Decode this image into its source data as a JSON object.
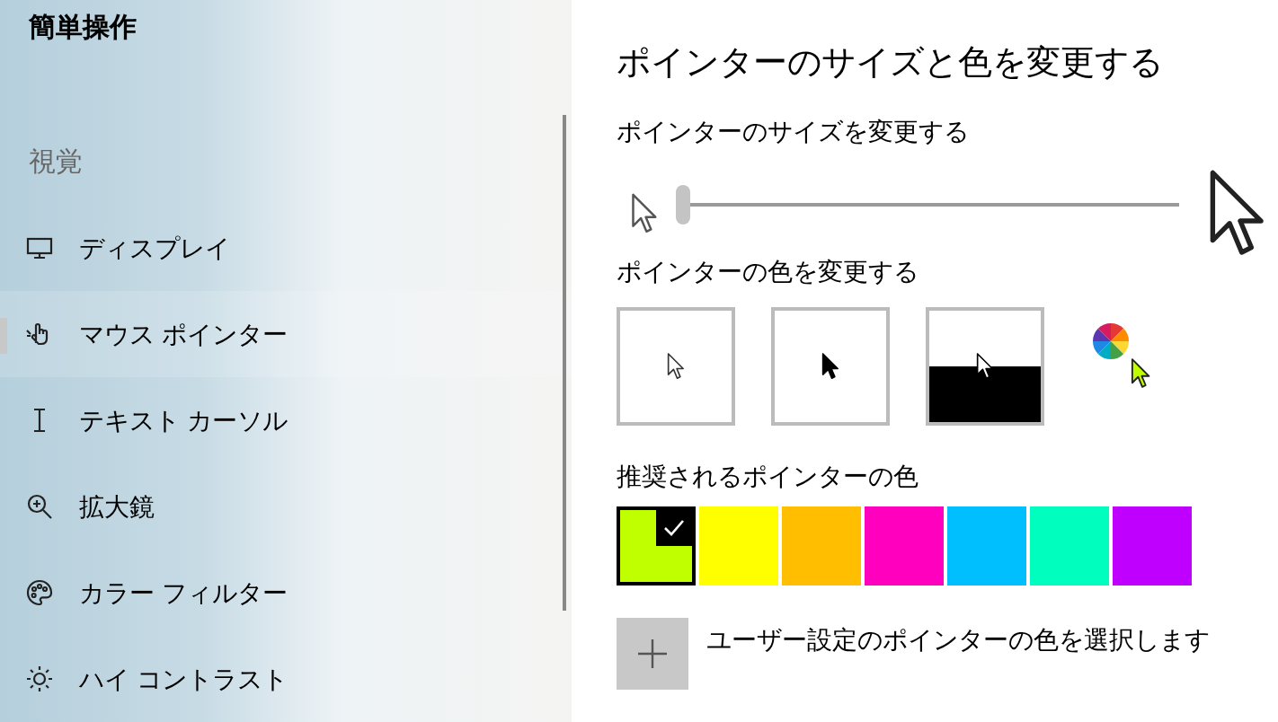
{
  "sidebar": {
    "title": "簡単操作",
    "section": "視覚",
    "items": [
      {
        "label": "ディスプレイ",
        "kind": "monitor",
        "selected": false
      },
      {
        "label": "マウス ポインター",
        "kind": "hand",
        "selected": true
      },
      {
        "label": "テキスト カーソル",
        "kind": "cursor",
        "selected": false
      },
      {
        "label": "拡大鏡",
        "kind": "zoom",
        "selected": false
      },
      {
        "label": "カラー フィルター",
        "kind": "palette",
        "selected": false
      },
      {
        "label": "ハイ コントラスト",
        "kind": "sun",
        "selected": false
      }
    ]
  },
  "main": {
    "title": "ポインターのサイズと色を変更する",
    "size": {
      "label": "ポインターのサイズを変更する",
      "level": 0.0
    },
    "color": {
      "label": "ポインターの色を変更する",
      "options": [
        {
          "kind": "white"
        },
        {
          "kind": "black"
        },
        {
          "kind": "inverted"
        },
        {
          "kind": "custom"
        }
      ]
    },
    "suggested": {
      "label": "推奨されるポインターの色",
      "swatches": [
        {
          "color": "#bfff00",
          "selected": true
        },
        {
          "color": "#ffff00",
          "selected": false
        },
        {
          "color": "#ffbf00",
          "selected": false
        },
        {
          "color": "#ff00bf",
          "selected": false
        },
        {
          "color": "#00bfff",
          "selected": false
        },
        {
          "color": "#00ffbf",
          "selected": false
        },
        {
          "color": "#bf00ff",
          "selected": false
        }
      ]
    },
    "custom": {
      "label": "ユーザー設定のポインターの色を選択します"
    }
  }
}
